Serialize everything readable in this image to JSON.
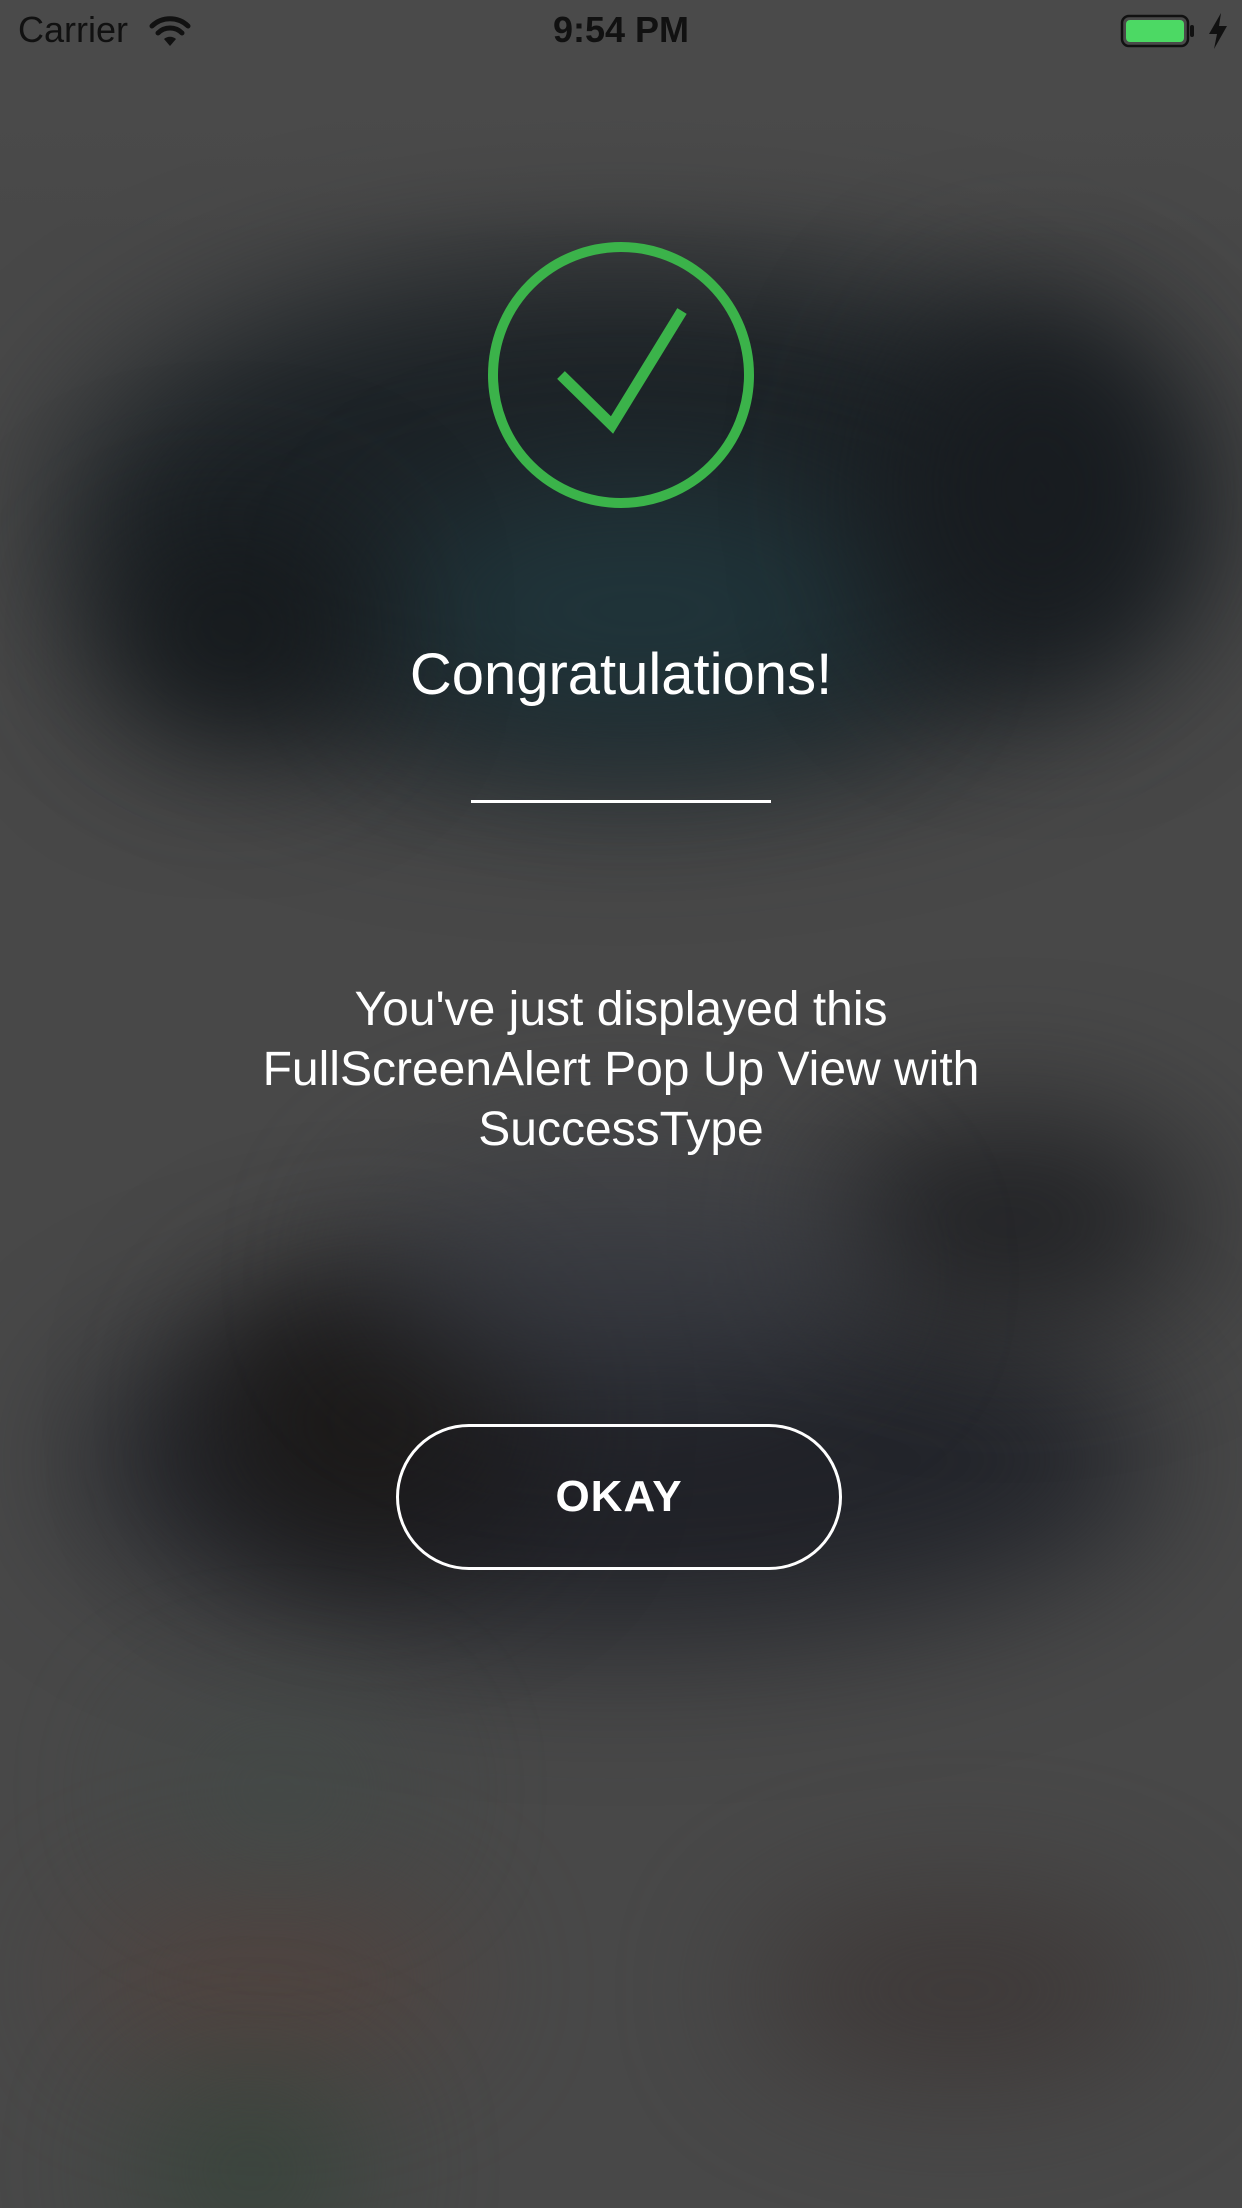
{
  "status_bar": {
    "carrier": "Carrier",
    "time": "9:54 PM",
    "wifi_icon": "wifi-icon",
    "battery_icon": "battery-icon",
    "charging_icon": "charging-bolt-icon",
    "battery_level": 1.0
  },
  "alert": {
    "icon": "success-checkmark-icon",
    "icon_color": "#3bb34a",
    "title": "Congratulations!",
    "message": "You've just displayed this FullScreenAlert Pop Up View with SuccessType",
    "button_label": "OKAY",
    "text_color": "#ffffff",
    "battery_color": "#4cd964"
  }
}
